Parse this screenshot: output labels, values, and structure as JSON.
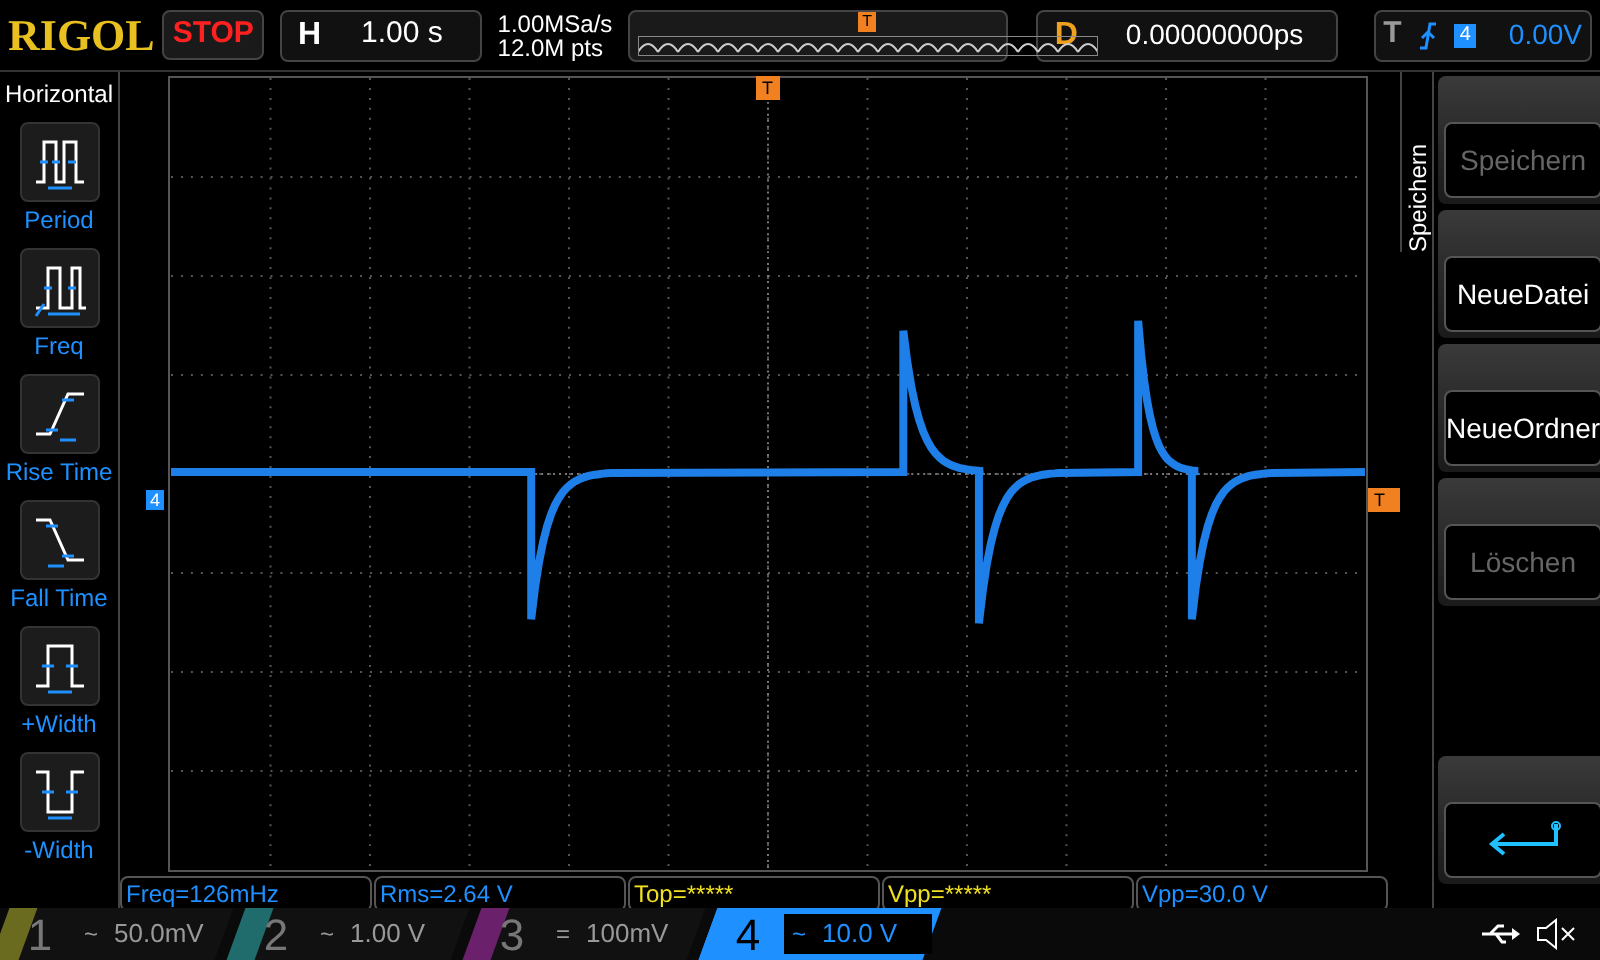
{
  "top_bar": {
    "logo": "RIGOL",
    "run_state": "STOP",
    "horizontal": {
      "label": "H",
      "value": "1.00 s"
    },
    "sample_rate": "1.00MSa/s",
    "memory_depth": "12.0M pts",
    "memory_marker": "T",
    "delay": {
      "label": "D",
      "value": "0.00000000ps"
    },
    "trigger": {
      "label": "T",
      "source": "4",
      "level": "0.00V"
    }
  },
  "left_menu": {
    "title": "Horizontal",
    "items": [
      {
        "kind": "period",
        "label": "Period"
      },
      {
        "kind": "freq",
        "label": "Freq"
      },
      {
        "kind": "rise",
        "label": "Rise Time"
      },
      {
        "kind": "fall",
        "label": "Fall Time"
      },
      {
        "kind": "pwidth",
        "label": "+Width"
      },
      {
        "kind": "nwidth",
        "label": "-Width"
      }
    ]
  },
  "screen": {
    "channel_marker": "4",
    "trigger_position_marker": "T",
    "trigger_level_marker": "T"
  },
  "right_menu": {
    "title": "Speichern",
    "items": [
      {
        "kind": "text",
        "label": "Speichern",
        "disabled": true
      },
      {
        "kind": "text",
        "label": "NeueDatei",
        "disabled": false
      },
      {
        "kind": "text",
        "label": "NeueOrdner",
        "disabled": false
      },
      {
        "kind": "text",
        "label": "Löschen",
        "disabled": true
      },
      {
        "kind": "spacer"
      },
      {
        "kind": "back"
      }
    ]
  },
  "measurements": [
    {
      "text": "Freq=126mHz",
      "color": "#1e90ff"
    },
    {
      "text": "Rms=2.64 V",
      "color": "#1e90ff"
    },
    {
      "text": "Top=*****",
      "color": "#f0e020"
    },
    {
      "text": "Vpp=*****",
      "color": "#f0e020"
    },
    {
      "text": "Vpp=30.0 V",
      "color": "#1e90ff"
    }
  ],
  "channels": [
    {
      "number": "1",
      "coupling": "~",
      "scale": "50.0mV",
      "color": "#6b6b20",
      "selected": false
    },
    {
      "number": "2",
      "coupling": "~",
      "scale": "1.00 V",
      "color": "#206b6b",
      "selected": false
    },
    {
      "number": "3",
      "coupling": "=",
      "scale": "100mV",
      "color": "#6b206b",
      "selected": false
    },
    {
      "number": "4",
      "coupling": "~",
      "scale": "10.0 V",
      "color": "#1e90ff",
      "selected": true
    }
  ]
}
